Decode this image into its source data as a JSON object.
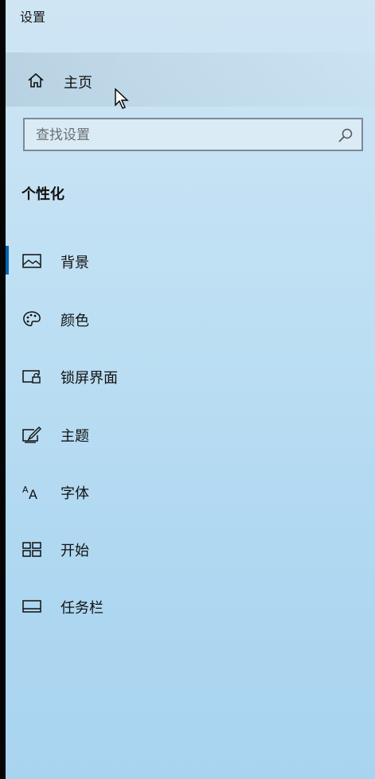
{
  "app": {
    "title": "设置"
  },
  "home": {
    "label": "主页",
    "icon": "home-icon"
  },
  "search": {
    "placeholder": "查找设置",
    "value": "",
    "icon": "search-icon"
  },
  "section": {
    "heading": "个性化"
  },
  "nav": {
    "items": [
      {
        "label": "背景",
        "icon": "picture-icon",
        "active": true
      },
      {
        "label": "颜色",
        "icon": "palette-icon",
        "active": false
      },
      {
        "label": "锁屏界面",
        "icon": "lock-screen-icon",
        "active": false
      },
      {
        "label": "主题",
        "icon": "theme-brush-icon",
        "active": false
      },
      {
        "label": "字体",
        "icon": "font-icon",
        "active": false
      },
      {
        "label": "开始",
        "icon": "start-grid-icon",
        "active": false
      },
      {
        "label": "任务栏",
        "icon": "taskbar-icon",
        "active": false
      }
    ]
  },
  "colors": {
    "accent": "#0063b1",
    "text": "#111111"
  }
}
